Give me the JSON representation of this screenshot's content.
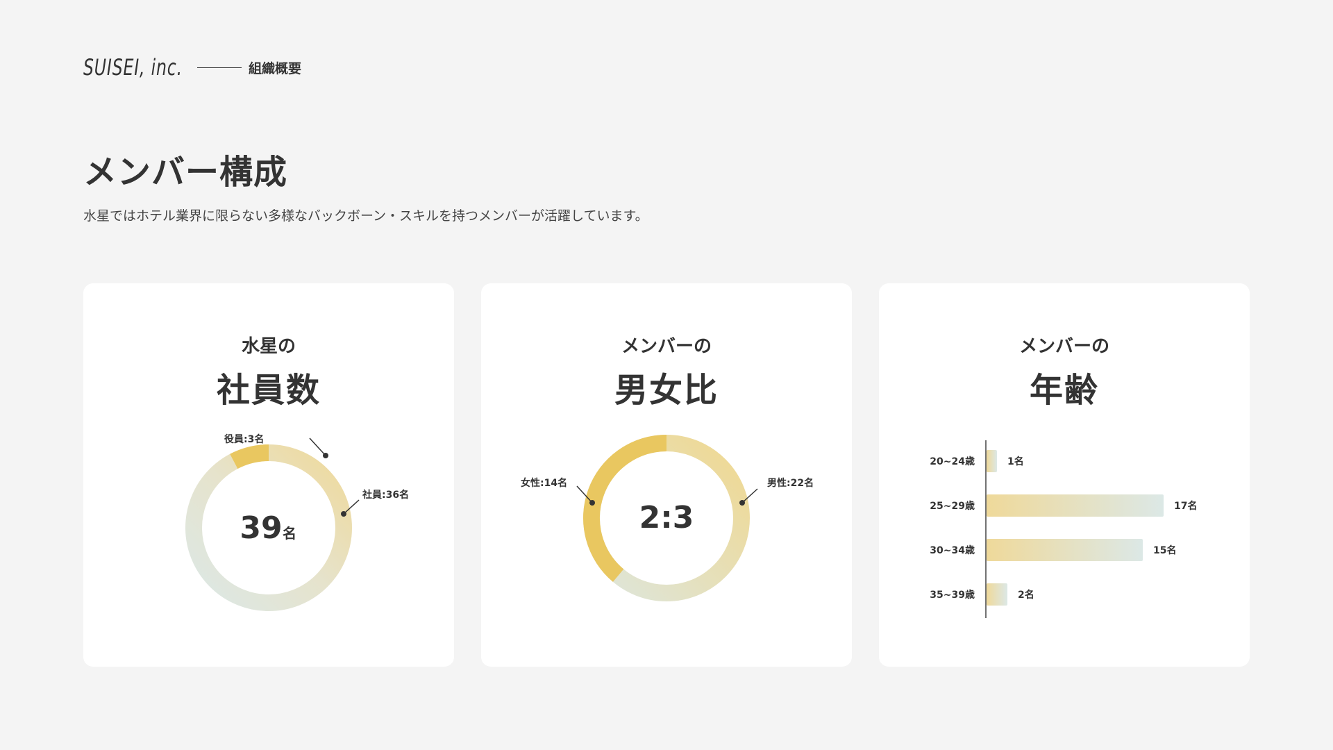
{
  "header": {
    "logo": "SUISEI, inc.",
    "section": "組織概要"
  },
  "page": {
    "title": "メンバー構成",
    "description": "水星ではホテル業界に限らない多様なバックボーン・スキルを持つメンバーが活躍しています。"
  },
  "colors": {
    "accent_gold": "#e9c760",
    "accent_light": "#efdb9c",
    "accent_pale": "#dce8e6",
    "text": "#333333"
  },
  "cards": [
    {
      "subtitle": "水星の",
      "title": "社員数"
    },
    {
      "subtitle": "メンバーの",
      "title": "男女比"
    },
    {
      "subtitle": "メンバーの",
      "title": "年齢"
    }
  ],
  "chart_data": [
    {
      "type": "pie",
      "center_value": "39",
      "center_unit": "名",
      "slices": [
        {
          "label": "役員",
          "label_text": "役員:3名",
          "value": 3
        },
        {
          "label": "社員",
          "label_text": "社員:36名",
          "value": 36
        }
      ]
    },
    {
      "type": "pie",
      "center_value": "2:3",
      "slices": [
        {
          "label": "女性",
          "label_text": "女性:14名",
          "value": 14
        },
        {
          "label": "男性",
          "label_text": "男性:22名",
          "value": 22
        }
      ]
    },
    {
      "type": "bar",
      "orientation": "horizontal",
      "categories": [
        "20~24歳",
        "25~29歳",
        "30~34歳",
        "35~39歳"
      ],
      "values": [
        1,
        17,
        15,
        2
      ],
      "value_labels": [
        "1名",
        "17名",
        "15名",
        "2名"
      ]
    }
  ]
}
